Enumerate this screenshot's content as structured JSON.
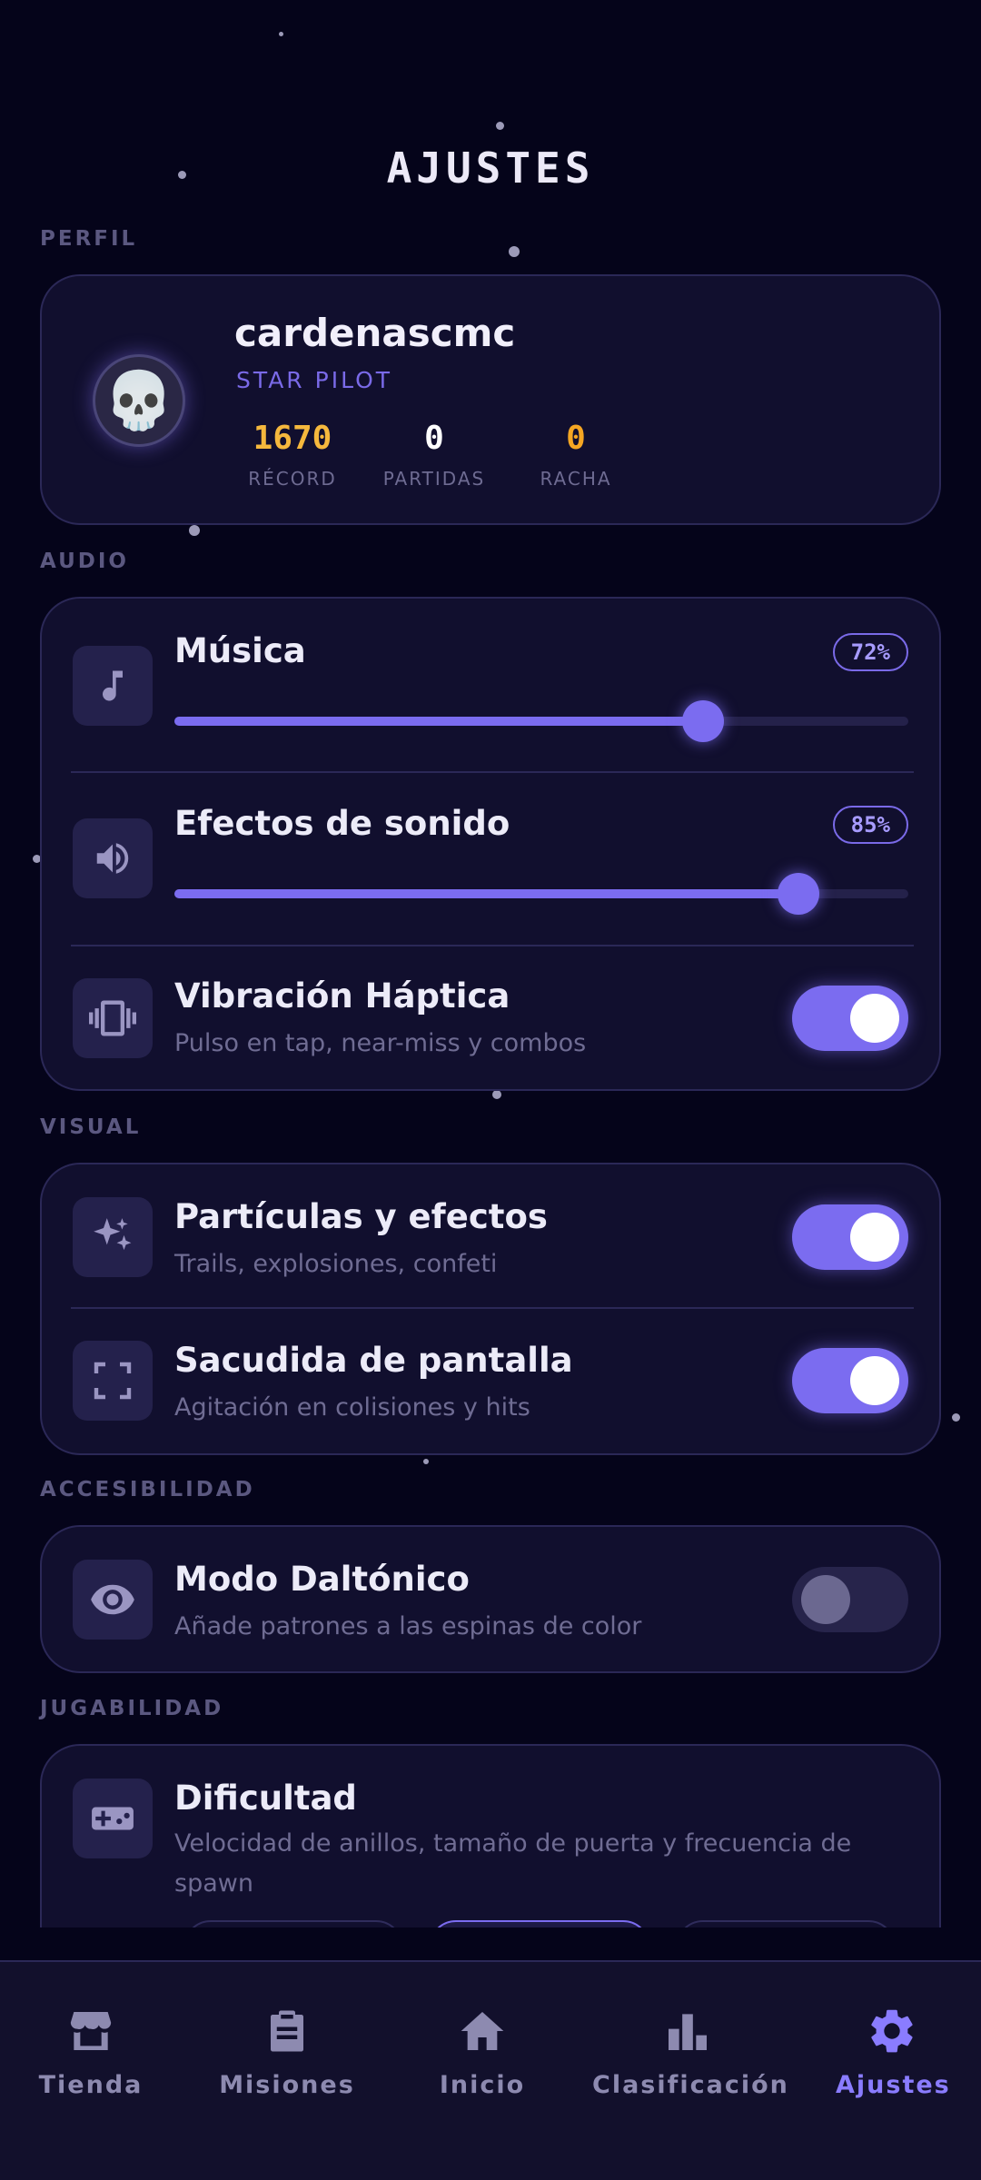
{
  "page": {
    "title": "AJUSTES"
  },
  "sections": {
    "profile": "PERFIL",
    "audio": "AUDIO",
    "visual": "VISUAL",
    "accessibility": "ACCESIBILIDAD",
    "gameplay": "JUGABILIDAD"
  },
  "profile": {
    "avatar_icon": "skull-icon",
    "username": "cardenascmc",
    "rank": "STAR PILOT",
    "stats": [
      {
        "value": "1670",
        "label": "RÉCORD",
        "color": "#f5b83d"
      },
      {
        "value": "0",
        "label": "PARTIDAS",
        "color": "#ffffff"
      },
      {
        "value": "0",
        "label": "RACHA",
        "color": "#f5a623"
      }
    ]
  },
  "audio": {
    "music": {
      "label": "Música",
      "percent_text": "72%",
      "level": 0.72,
      "icon": "music-note-icon"
    },
    "sfx": {
      "label": "Efectos de sonido",
      "percent_text": "85%",
      "level": 0.85,
      "icon": "speaker-icon"
    },
    "haptics": {
      "label": "Vibración Háptica",
      "description": "Pulso en tap, near-miss y combos",
      "enabled": true,
      "icon": "vibration-icon"
    }
  },
  "visual": {
    "particles": {
      "label": "Partículas y efectos",
      "description": "Trails, explosiones, confeti",
      "enabled": true,
      "icon": "sparkles-icon"
    },
    "shake": {
      "label": "Sacudida de pantalla",
      "description": "Agitación en colisiones y hits",
      "enabled": true,
      "icon": "fullscreen-icon"
    }
  },
  "accessibility": {
    "colorblind": {
      "label": "Modo Daltónico",
      "description": "Añade patrones a las espinas de color",
      "enabled": false,
      "icon": "eye-icon"
    }
  },
  "gameplay": {
    "difficulty": {
      "label": "Dificultad",
      "description": "Velocidad de anillos, tamaño de puerta y frecuencia de spawn",
      "icon": "gamepad-icon"
    }
  },
  "nav": {
    "items": [
      {
        "label": "Tienda",
        "icon": "store-icon"
      },
      {
        "label": "Misiones",
        "icon": "clipboard-icon"
      },
      {
        "label": "Inicio",
        "icon": "home-icon"
      },
      {
        "label": "Clasificación",
        "icon": "bar-chart-icon"
      },
      {
        "label": "Ajustes",
        "icon": "gear-icon",
        "active": true
      }
    ]
  },
  "colors": {
    "accent": "#7b6cf0",
    "background": "#05041a",
    "card": "#110f2e"
  }
}
